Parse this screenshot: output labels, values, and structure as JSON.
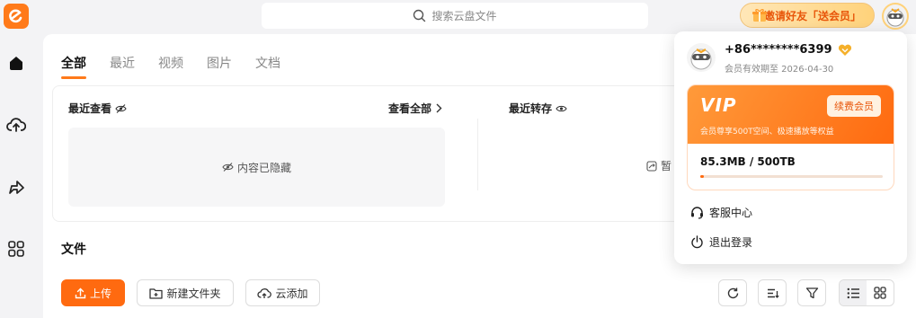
{
  "topbar": {
    "search_placeholder": "搜索云盘文件",
    "invite_label": "邀请好友「送会员」"
  },
  "tabs": [
    {
      "label": "全部",
      "active": true
    },
    {
      "label": "最近",
      "active": false
    },
    {
      "label": "视频",
      "active": false
    },
    {
      "label": "图片",
      "active": false
    },
    {
      "label": "文档",
      "active": false
    }
  ],
  "recent": {
    "viewed_title": "最近查看",
    "view_all": "查看全部",
    "transferred_title": "最近转存",
    "hidden_text": "内容已隐藏",
    "transferred_empty_text": "暂"
  },
  "files": {
    "title": "文件",
    "upload_label": "上传",
    "new_folder_label": "新建文件夹",
    "cloud_add_label": "云添加"
  },
  "popup": {
    "phone": "+86********6399",
    "expiry": "会员有效期至 2026-04-30",
    "vip_logo": "VIP",
    "renew_label": "续费会员",
    "vip_desc": "会员尊享500T空间、极速播放等权益",
    "storage_text": "85.3MB / 500TB",
    "storage_fraction": 0.0002,
    "service_label": "客服中心",
    "logout_label": "退出登录"
  },
  "colors": {
    "accent": "#ff6a10",
    "vip_badge": "#f5b02a"
  },
  "icons": [
    "app-logo-icon",
    "home-icon",
    "upload-cloud-icon",
    "share-icon",
    "apps-grid-icon",
    "search-icon",
    "gift-icon",
    "eye-hidden-icon",
    "eye-icon",
    "chevron-right-icon",
    "refresh-icon",
    "sort-icon",
    "filter-icon",
    "list-view-icon",
    "grid-view-icon",
    "headset-icon",
    "power-icon"
  ]
}
